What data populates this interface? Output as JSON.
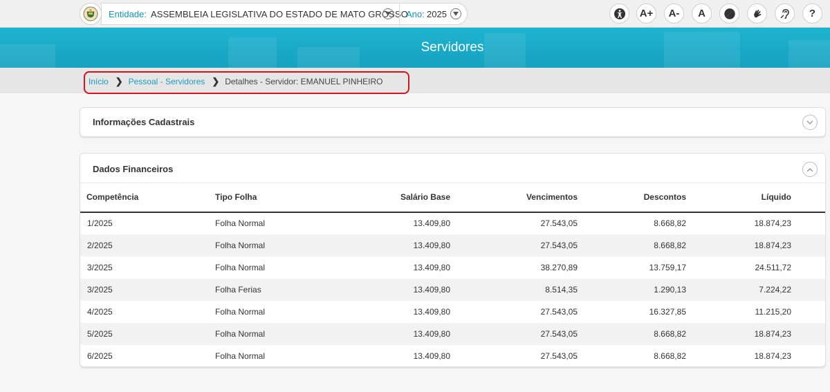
{
  "topbar": {
    "entity_label": "Entidade:",
    "entity_value": "ASSEMBLEIA LEGISLATIVA DO ESTADO DE MATO GROSSO",
    "year_label": "Ano:",
    "year_value": "2025",
    "accessibility": [
      {
        "name": "accessibility-icon",
        "label": ""
      },
      {
        "name": "font-increase-button",
        "label": "A+"
      },
      {
        "name": "font-decrease-button",
        "label": "A-"
      },
      {
        "name": "font-reset-button",
        "label": "A"
      },
      {
        "name": "contrast-icon",
        "label": ""
      },
      {
        "name": "sign-language-icon",
        "label": ""
      },
      {
        "name": "hearing-icon",
        "label": ""
      },
      {
        "name": "help-button",
        "label": "?"
      }
    ]
  },
  "banner": {
    "title": "Servidores"
  },
  "breadcrumb": {
    "home": "Início",
    "section": "Pessoal - Servidores",
    "current": "Detalhes - Servidor: EMANUEL PINHEIRO"
  },
  "panels": {
    "cadastral_title": "Informações Cadastrais",
    "financial_title": "Dados Financeiros"
  },
  "table": {
    "headers": [
      "Competência",
      "Tipo Folha",
      "Salário Base",
      "Vencimentos",
      "Descontos",
      "Líquido"
    ],
    "rows": [
      [
        "1/2025",
        "Folha Normal",
        "13.409,80",
        "27.543,05",
        "8.668,82",
        "18.874,23"
      ],
      [
        "2/2025",
        "Folha Normal",
        "13.409,80",
        "27.543,05",
        "8.668,82",
        "18.874,23"
      ],
      [
        "3/2025",
        "Folha Normal",
        "13.409,80",
        "38.270,89",
        "13.759,17",
        "24.511,72"
      ],
      [
        "3/2025",
        "Folha Ferias",
        "13.409,80",
        "8.514,35",
        "1.290,13",
        "7.224,22"
      ],
      [
        "4/2025",
        "Folha Normal",
        "13.409,80",
        "27.543,05",
        "16.327,85",
        "11.215,20"
      ],
      [
        "5/2025",
        "Folha Normal",
        "13.409,80",
        "27.543,05",
        "8.668,82",
        "18.874,23"
      ],
      [
        "6/2025",
        "Folha Normal",
        "13.409,80",
        "27.543,05",
        "8.668,82",
        "18.874,23"
      ]
    ]
  },
  "colors": {
    "accent": "#1fb3d0",
    "link": "#1a9bc0",
    "highlight": "#d3141b"
  }
}
